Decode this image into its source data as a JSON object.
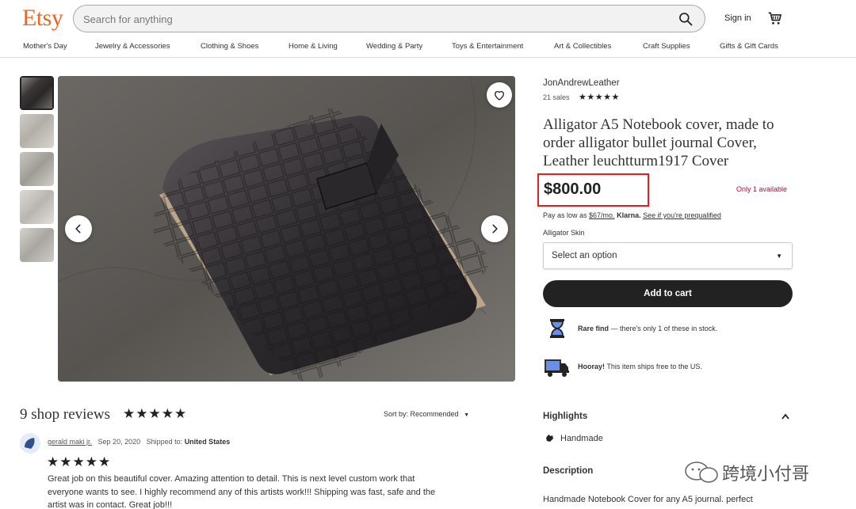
{
  "header": {
    "logo": "Etsy",
    "search_placeholder": "Search for anything",
    "signin": "Sign in"
  },
  "nav": {
    "items": [
      "Mother's Day",
      "Jewelry & Accessories",
      "Clothing & Shoes",
      "Home & Living",
      "Wedding & Party",
      "Toys & Entertainment",
      "Art & Collectibles",
      "Craft Supplies",
      "Gifts & Gift Cards"
    ]
  },
  "listing": {
    "shop_name": "JonAndrewLeather",
    "sales": "21 sales",
    "rating_stars": "★★★★★",
    "title": "Alligator A5 Notebook cover, made to order alligator bullet journal Cover, Leather leuchtturm1917 Cover",
    "price": "$800.00",
    "availability": "Only 1 available",
    "klarna": {
      "prefix": "Pay as low as ",
      "amount": "$67/mo.",
      "brand": "Klarna.",
      "link": "See if you're prequalified"
    },
    "option_label": "Alligator Skin",
    "option_value": "Select an option",
    "add_to_cart": "Add to cart",
    "rare": {
      "bold": "Rare find",
      "text": " — there's only 1 of these in stock."
    },
    "shipping": {
      "bold": "Hooray!",
      "text": " This item ships free to the US."
    }
  },
  "highlights": {
    "heading": "Highlights",
    "item": "Handmade"
  },
  "description": {
    "heading": "Description",
    "text": "Handmade Notebook Cover for any A5 journal. perfect"
  },
  "reviews": {
    "title": "9 shop reviews",
    "stars": "★★★★★",
    "sort_label": "Sort by:",
    "sort_value": "Recommended",
    "review": {
      "name": "gerald maki jr.",
      "date": "Sep 20, 2020",
      "shipped_label": "Shipped to:",
      "shipped_to": "United States",
      "stars": "★★★★★",
      "text": "Great job on this beautiful cover. Amazing attention to detail. This is next level custom work that everyone wants to see. I highly recommend any of this artists work!!! Shipping was fast, safe and the artist was in contact. Great job!!!"
    }
  },
  "watermark": {
    "text": "跨境小付哥"
  },
  "colors": {
    "brand": "#F1641E",
    "price_box": "#e02020",
    "availability": "#b3093c",
    "button": "#222222"
  }
}
